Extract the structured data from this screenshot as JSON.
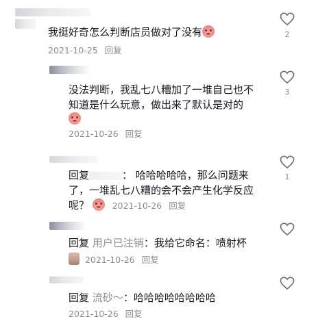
{
  "comments": [
    {
      "text": "我挺好奇怎么判断店员做对了没有",
      "date": "2021-10-25",
      "reply_label": "回复",
      "likes": "2"
    },
    {
      "text_line1": "没法判断，我乱七八糟加了一堆自己也不",
      "text_line2": "知道是什么玩意，做出来了默认是对的",
      "date": "2021-10-26",
      "reply_label": "回复",
      "likes": "3"
    },
    {
      "reply_prefix": "回复",
      "text_line1": "：  哈哈哈哈哈，那么问题来",
      "text_line2": "了，一堆乱七八糟的会不会产生化学反应",
      "text_line3": "呢？",
      "date": "2021-10-26",
      "reply_label": "回复",
      "likes": "1"
    },
    {
      "reply_prefix": "回复",
      "reply_to": "用户已注销",
      "text": "：我给它命名：喷射杯",
      "date": "2021-10-26",
      "reply_label": "回复",
      "likes": ""
    },
    {
      "reply_prefix": "回复",
      "reply_to": "流砂～",
      "text": "：哈哈哈哈哈哈哈哈",
      "date": "2021-10-26",
      "reply_label": "回复",
      "likes": ""
    }
  ],
  "icons": {
    "like": "heart-outline-icon",
    "emoji_laugh": "laughing-face-emoji",
    "emoji_portrait": "portrait-emoji"
  },
  "colors": {
    "text": "#161823",
    "meta": "#8a8b91",
    "heart_stroke": "#6b6d73"
  }
}
